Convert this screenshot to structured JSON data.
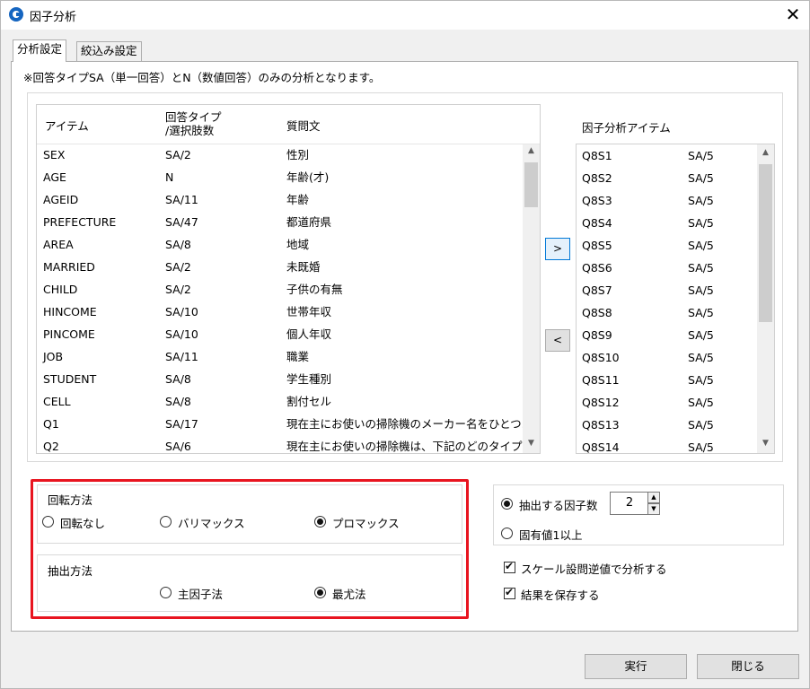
{
  "window": {
    "title": "因子分析"
  },
  "tabs": [
    {
      "label": "分析設定",
      "active": true
    },
    {
      "label": "絞込み設定",
      "active": false
    }
  ],
  "note": "※回答タイプSA（単一回答）とN（数値回答）のみの分析となります。",
  "item_list": {
    "headers": {
      "item": "アイテム",
      "type_line1": "回答タイプ",
      "type_line2": "/選択肢数",
      "question": "質問文"
    },
    "rows": [
      {
        "item": "SEX",
        "type": "SA/2",
        "question": "性別"
      },
      {
        "item": "AGE",
        "type": "N",
        "question": "年齢(才)"
      },
      {
        "item": "AGEID",
        "type": "SA/11",
        "question": "年齢"
      },
      {
        "item": "PREFECTURE",
        "type": "SA/47",
        "question": "都道府県"
      },
      {
        "item": "AREA",
        "type": "SA/8",
        "question": "地域"
      },
      {
        "item": "MARRIED",
        "type": "SA/2",
        "question": "未既婚"
      },
      {
        "item": "CHILD",
        "type": "SA/2",
        "question": "子供の有無"
      },
      {
        "item": "HINCOME",
        "type": "SA/10",
        "question": "世帯年収"
      },
      {
        "item": "PINCOME",
        "type": "SA/10",
        "question": "個人年収"
      },
      {
        "item": "JOB",
        "type": "SA/11",
        "question": "職業"
      },
      {
        "item": "STUDENT",
        "type": "SA/8",
        "question": "学生種別"
      },
      {
        "item": "CELL",
        "type": "SA/8",
        "question": "割付セル"
      },
      {
        "item": "Q1",
        "type": "SA/17",
        "question": "現在主にお使いの掃除機のメーカー名をひとつ..."
      },
      {
        "item": "Q2",
        "type": "SA/6",
        "question": "現在主にお使いの掃除機は、下記のどのタイプ..."
      }
    ]
  },
  "move_buttons": {
    "add": ">",
    "remove": "<"
  },
  "factor_list": {
    "title": "因子分析アイテム",
    "rows": [
      {
        "item": "Q8S1",
        "type": "SA/5"
      },
      {
        "item": "Q8S2",
        "type": "SA/5"
      },
      {
        "item": "Q8S3",
        "type": "SA/5"
      },
      {
        "item": "Q8S4",
        "type": "SA/5"
      },
      {
        "item": "Q8S5",
        "type": "SA/5"
      },
      {
        "item": "Q8S6",
        "type": "SA/5"
      },
      {
        "item": "Q8S7",
        "type": "SA/5"
      },
      {
        "item": "Q8S8",
        "type": "SA/5"
      },
      {
        "item": "Q8S9",
        "type": "SA/5"
      },
      {
        "item": "Q8S10",
        "type": "SA/5"
      },
      {
        "item": "Q8S11",
        "type": "SA/5"
      },
      {
        "item": "Q8S12",
        "type": "SA/5"
      },
      {
        "item": "Q8S13",
        "type": "SA/5"
      },
      {
        "item": "Q8S14",
        "type": "SA/5"
      }
    ]
  },
  "rotation": {
    "title": "回転方法",
    "options": [
      {
        "label": "回転なし",
        "selected": false
      },
      {
        "label": "バリマックス",
        "selected": false
      },
      {
        "label": "プロマックス",
        "selected": true
      }
    ]
  },
  "extraction": {
    "title": "抽出方法",
    "options": [
      {
        "label": "主因子法",
        "selected": false
      },
      {
        "label": "最尤法",
        "selected": true
      }
    ]
  },
  "factor_count": {
    "option_count_label": "抽出する因子数",
    "option_count_selected": true,
    "count_value": "2",
    "option_eigen_label": "固有値1以上",
    "option_eigen_selected": false
  },
  "checkboxes": [
    {
      "label": "スケール設問逆値で分析する",
      "checked": true
    },
    {
      "label": "結果を保存する",
      "checked": true
    }
  ],
  "footer": {
    "run_label": "実行",
    "close_label": "閉じる"
  },
  "colors": {
    "highlight_border": "#e8141f",
    "accent": "#0078d7",
    "logo": "#1565c0"
  }
}
